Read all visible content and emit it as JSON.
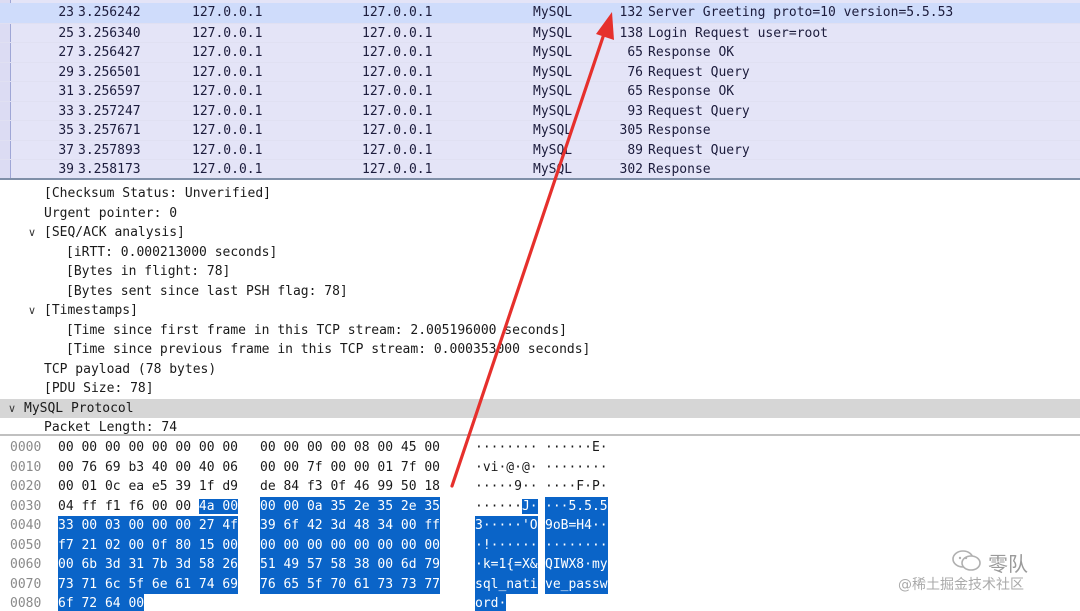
{
  "packet_list": {
    "rows": [
      {
        "no": "23",
        "time": "3.256242",
        "src": "127.0.0.1",
        "dst": "127.0.0.1",
        "proto": "MySQL",
        "len": "132",
        "info": "Server Greeting proto=10 version=5.5.53"
      },
      {
        "no": "25",
        "time": "3.256340",
        "src": "127.0.0.1",
        "dst": "127.0.0.1",
        "proto": "MySQL",
        "len": "138",
        "info": "Login Request user=root"
      },
      {
        "no": "27",
        "time": "3.256427",
        "src": "127.0.0.1",
        "dst": "127.0.0.1",
        "proto": "MySQL",
        "len": "65",
        "info": "Response OK"
      },
      {
        "no": "29",
        "time": "3.256501",
        "src": "127.0.0.1",
        "dst": "127.0.0.1",
        "proto": "MySQL",
        "len": "76",
        "info": "Request Query"
      },
      {
        "no": "31",
        "time": "3.256597",
        "src": "127.0.0.1",
        "dst": "127.0.0.1",
        "proto": "MySQL",
        "len": "65",
        "info": "Response OK"
      },
      {
        "no": "33",
        "time": "3.257247",
        "src": "127.0.0.1",
        "dst": "127.0.0.1",
        "proto": "MySQL",
        "len": "93",
        "info": "Request Query"
      },
      {
        "no": "35",
        "time": "3.257671",
        "src": "127.0.0.1",
        "dst": "127.0.0.1",
        "proto": "MySQL",
        "len": "305",
        "info": "Response"
      },
      {
        "no": "37",
        "time": "3.257893",
        "src": "127.0.0.1",
        "dst": "127.0.0.1",
        "proto": "MySQL",
        "len": "89",
        "info": "Request Query"
      },
      {
        "no": "39",
        "time": "3.258173",
        "src": "127.0.0.1",
        "dst": "127.0.0.1",
        "proto": "MySQL",
        "len": "302",
        "info": "Response"
      }
    ],
    "selected_index": 0
  },
  "details": {
    "rows": [
      {
        "text": "[Checksum Status: Unverified]",
        "caret": ""
      },
      {
        "text": "Urgent pointer: 0",
        "caret": ""
      },
      {
        "text": "[SEQ/ACK analysis]",
        "caret": "v"
      },
      {
        "text": "[iRTT: 0.000213000 seconds]",
        "caret": ""
      },
      {
        "text": "[Bytes in flight: 78]",
        "caret": ""
      },
      {
        "text": "[Bytes sent since last PSH flag: 78]",
        "caret": ""
      },
      {
        "text": "[Timestamps]",
        "caret": "v"
      },
      {
        "text": "[Time since first frame in this TCP stream: 2.005196000 seconds]",
        "caret": ""
      },
      {
        "text": "[Time since previous frame in this TCP stream: 0.000353000 seconds]",
        "caret": ""
      },
      {
        "text": "TCP payload (78 bytes)",
        "caret": ""
      },
      {
        "text": "[PDU Size: 78]",
        "caret": ""
      },
      {
        "text": "MySQL Protocol",
        "caret": "v"
      },
      {
        "text": "Packet Length: 74",
        "caret": ""
      }
    ]
  },
  "hex": {
    "rows": [
      {
        "off": "0000",
        "a": "00 00 00 00 00 00 00 00",
        "b": "00 00 00 00 08 00 45 00",
        "asc_a": "········",
        "asc_b": "······E·"
      },
      {
        "off": "0010",
        "a": "00 76 69 b3 40 00 40 06",
        "b": "00 00 7f 00 00 01 7f 00",
        "asc_a": "·vi·@·@·",
        "asc_b": "········"
      },
      {
        "off": "0020",
        "a": "00 01 0c ea e5 39 1f d9",
        "b": "de 84 f3 0f 46 99 50 18",
        "asc_a": "·····9··",
        "asc_b": "····F·P·"
      },
      {
        "off": "0030",
        "a": "04 ff f1 f6 00 00 4a 00",
        "b": "00 00 0a 35 2e 35 2e 35",
        "asc_a": "······J·",
        "asc_b": "···5.5.5"
      },
      {
        "off": "0040",
        "a": "33 00 03 00 00 00 27 4f",
        "b": "39 6f 42 3d 48 34 00 ff",
        "asc_a": "3·····'O",
        "asc_b": "9oB=H4··"
      },
      {
        "off": "0050",
        "a": "f7 21 02 00 0f 80 15 00",
        "b": "00 00 00 00 00 00 00 00",
        "asc_a": "·!······",
        "asc_b": "········"
      },
      {
        "off": "0060",
        "a": "00 6b 3d 31 7b 3d 58 26",
        "b": "51 49 57 58 38 00 6d 79",
        "asc_a": "·k=1{=X&",
        "asc_b": "QIWX8·my"
      },
      {
        "off": "0070",
        "a": "73 71 6c 5f 6e 61 74 69",
        "b": "76 65 5f 70 61 73 73 77",
        "asc_a": "sql_nati",
        "asc_b": "ve_passw"
      },
      {
        "off": "0080",
        "a": "6f 72 64 00",
        "b": "",
        "asc_a": "ord·",
        "asc_b": ""
      }
    ]
  },
  "colors": {
    "list_bg": "#e4e4f7",
    "selected_bg": "#cfdcfb",
    "hex_selection": "#0a64c8",
    "detail_highlight": "#d6d6d6",
    "arrow": "#e6302c"
  },
  "watermark": {
    "title": "零队",
    "subtitle": "@稀土掘金技术社区",
    "logo_icon": "wechat-logo-icon"
  }
}
